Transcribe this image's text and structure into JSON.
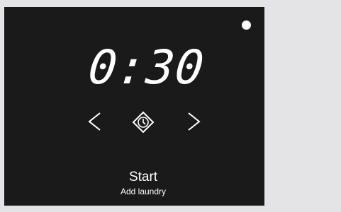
{
  "display": {
    "time": "0:30"
  },
  "controls": {
    "prev_icon": "chevron-left-icon",
    "timer_icon": "timer-diamond-icon",
    "next_icon": "chevron-right-icon"
  },
  "start": {
    "label": "Start",
    "sublabel": "Add laundry"
  },
  "colors": {
    "panel": "#1a1a1a",
    "foreground": "#ffffff",
    "background": "#e4e4e6"
  }
}
